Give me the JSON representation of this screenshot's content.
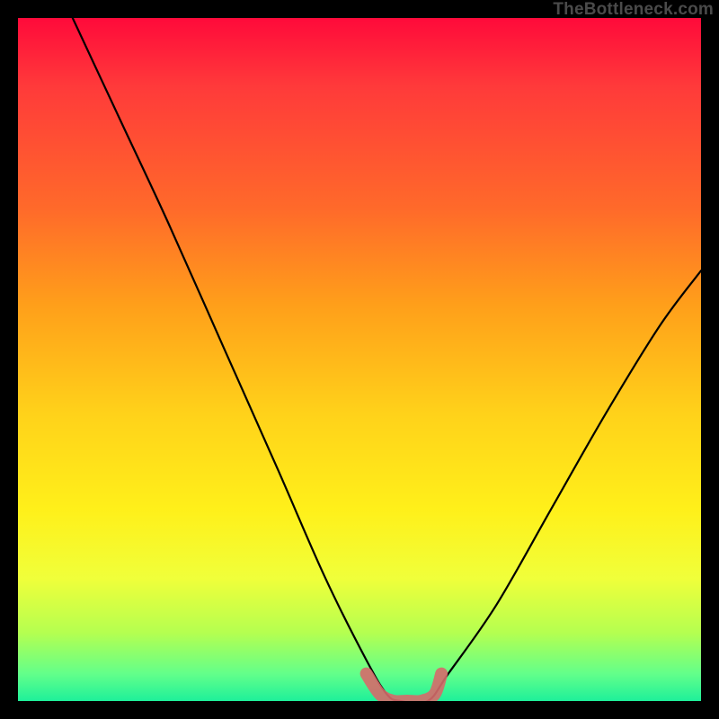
{
  "watermark": "TheBottleneck.com",
  "chart_data": {
    "type": "line",
    "title": "",
    "xlabel": "",
    "ylabel": "",
    "xlim": [
      0,
      100
    ],
    "ylim": [
      0,
      100
    ],
    "grid": false,
    "legend": false,
    "background_gradient": {
      "top": "#ff0a3a",
      "upper_mid": "#ff9f1a",
      "mid": "#fff01a",
      "lower": "#63ff8a",
      "bottom": "#1ef09a"
    },
    "series": [
      {
        "name": "primary-curve",
        "color": "#000000",
        "x": [
          8,
          15,
          22,
          30,
          38,
          45,
          51,
          54,
          56,
          60,
          63,
          70,
          78,
          86,
          94,
          100
        ],
        "y": [
          100,
          85,
          70,
          52,
          34,
          18,
          6,
          1,
          0,
          0,
          4,
          14,
          28,
          42,
          55,
          63
        ]
      },
      {
        "name": "flat-marker",
        "color": "#d66a6a",
        "x": [
          51,
          53,
          55,
          57,
          59,
          61,
          62
        ],
        "y": [
          4,
          1,
          0,
          0,
          0,
          1,
          4
        ]
      }
    ],
    "annotations": []
  }
}
